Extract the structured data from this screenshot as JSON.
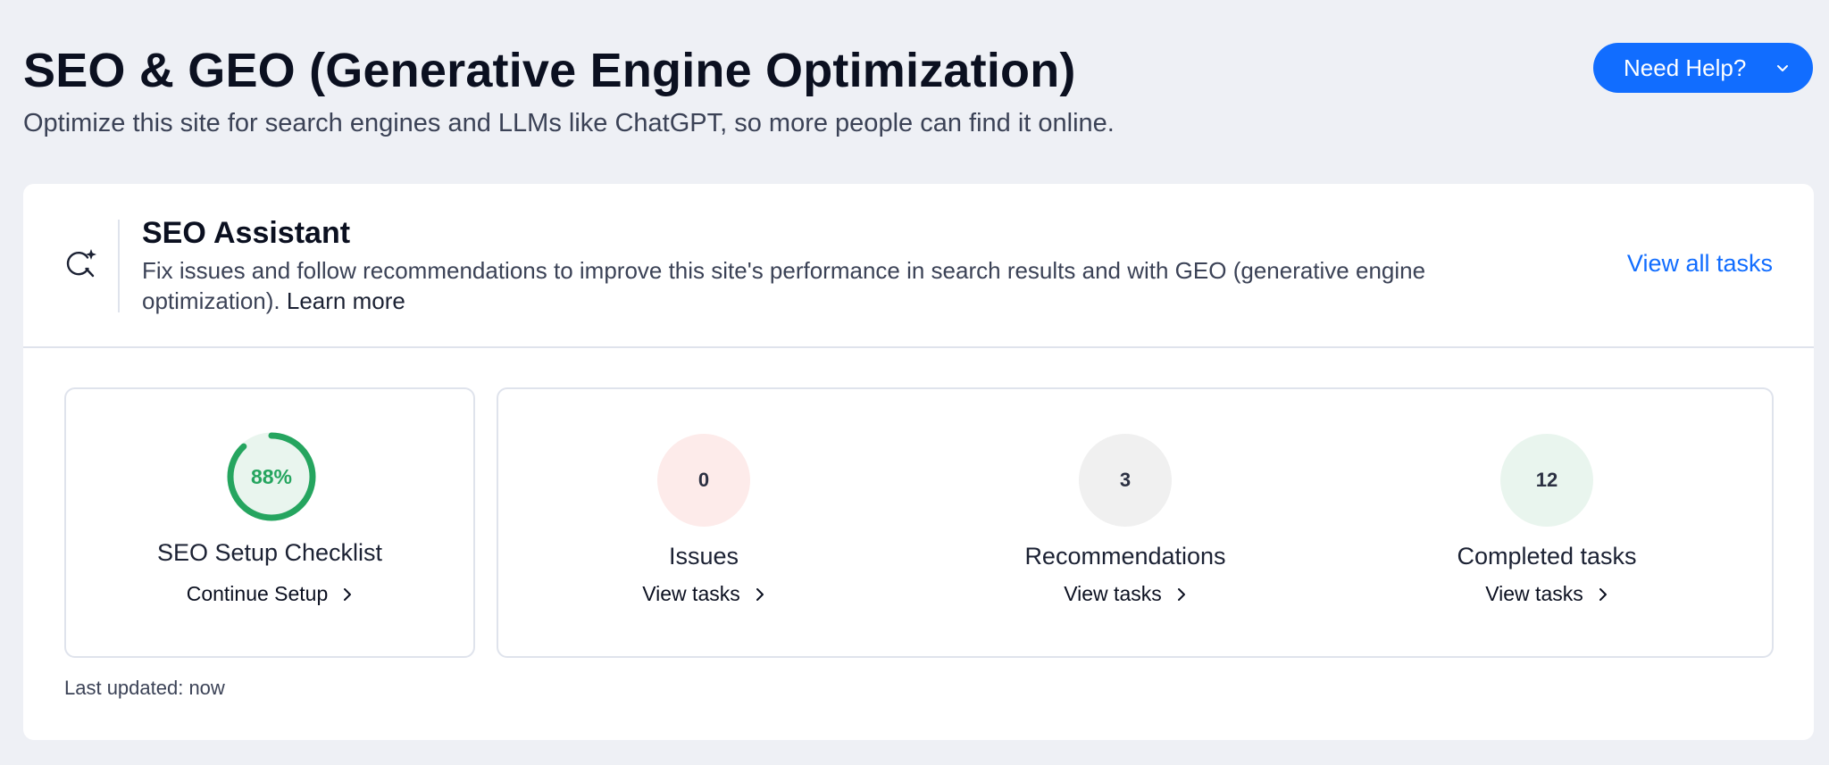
{
  "page": {
    "title": "SEO & GEO (Generative Engine Optimization)",
    "subtitle": "Optimize this site for search engines and LLMs like ChatGPT, so more people can find it online."
  },
  "help": {
    "label": "Need Help?",
    "icon": "chevron-down-icon"
  },
  "assistant": {
    "icon": "search-sparkle-icon",
    "title": "SEO Assistant",
    "description": "Fix issues and follow recommendations to improve this site's performance in search results and with GEO (generative engine optimization).",
    "learn_more": "Learn more",
    "view_all": "View all tasks"
  },
  "checklist": {
    "progress_label": "88%",
    "progress_value": 0.88,
    "title": "SEO Setup Checklist",
    "link": "Continue Setup"
  },
  "stats": [
    {
      "count": "0",
      "label": "Issues",
      "link": "View tasks",
      "color": "#fdebea"
    },
    {
      "count": "3",
      "label": "Recommendations",
      "link": "View tasks",
      "color": "#f0f0f0"
    },
    {
      "count": "12",
      "label": "Completed tasks",
      "link": "View tasks",
      "color": "#e9f5ee"
    }
  ],
  "footer": {
    "last_updated": "Last updated: now"
  },
  "colors": {
    "accent": "#116dff",
    "progress": "#25a55f",
    "progress_track": "#e9f5ee",
    "background": "#eef0f5"
  }
}
